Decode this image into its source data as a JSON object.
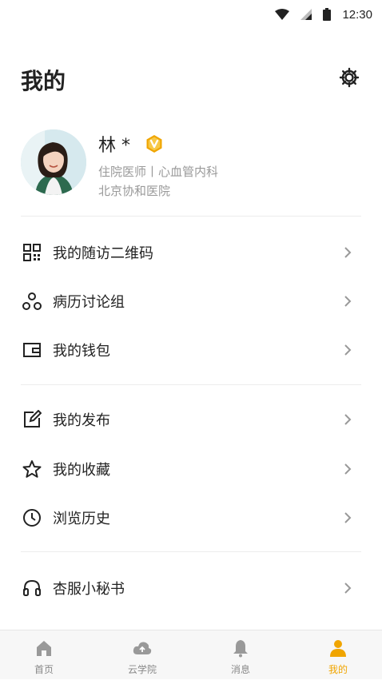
{
  "status_bar": {
    "time": "12:30"
  },
  "header": {
    "title": "我的"
  },
  "profile": {
    "name": "林 *",
    "title": "住院医师丨心血管内科",
    "hospital": "北京协和医院"
  },
  "menu_groups": [
    [
      {
        "label": "我的随访二维码",
        "icon": "qr-code-icon"
      },
      {
        "label": "病历讨论组",
        "icon": "group-icon"
      },
      {
        "label": "我的钱包",
        "icon": "wallet-icon"
      }
    ],
    [
      {
        "label": "我的发布",
        "icon": "edit-icon"
      },
      {
        "label": "我的收藏",
        "icon": "star-icon"
      },
      {
        "label": "浏览历史",
        "icon": "clock-icon"
      }
    ],
    [
      {
        "label": "杏服小秘书",
        "icon": "headset-icon"
      }
    ]
  ],
  "bottom_nav": [
    {
      "label": "首页",
      "icon": "home-icon",
      "active": false
    },
    {
      "label": "云学院",
      "icon": "cloud-icon",
      "active": false
    },
    {
      "label": "消息",
      "icon": "bell-icon",
      "active": false
    },
    {
      "label": "我的",
      "icon": "person-icon",
      "active": true
    }
  ],
  "colors": {
    "accent": "#f0a500",
    "muted_text": "#999999",
    "nav_inactive": "#888888"
  }
}
